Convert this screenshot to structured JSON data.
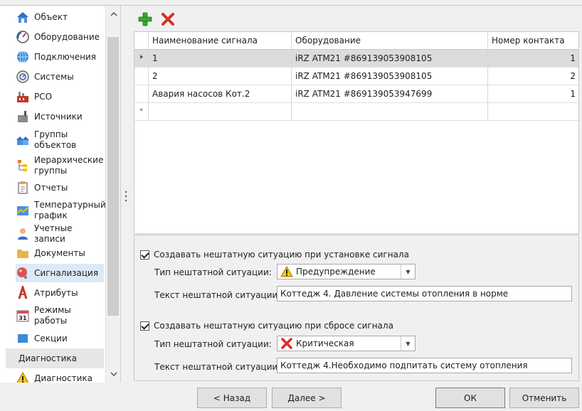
{
  "sidebar": {
    "items": [
      {
        "label": "Объект",
        "icon": "home-icon"
      },
      {
        "label": "Оборудование",
        "icon": "gauge-icon"
      },
      {
        "label": "Подключения",
        "icon": "globe-icon"
      },
      {
        "label": "Системы",
        "icon": "meter-icon"
      },
      {
        "label": "РСО",
        "icon": "factory-icon"
      },
      {
        "label": "Источники",
        "icon": "boiler-icon"
      },
      {
        "label": "Группы объектов",
        "icon": "houses-icon"
      },
      {
        "label": "Иерархические группы",
        "icon": "tree-icon"
      },
      {
        "label": "Отчеты",
        "icon": "report-icon"
      },
      {
        "label": "Температурный график",
        "icon": "temp-chart-icon"
      },
      {
        "label": "Учетные записи",
        "icon": "user-icon"
      },
      {
        "label": "Документы",
        "icon": "folder-icon"
      },
      {
        "label": "Сигнализация",
        "icon": "alarm-icon"
      },
      {
        "label": "Атрибуты",
        "icon": "attribute-icon"
      },
      {
        "label": "Режимы работы",
        "icon": "calendar-icon"
      },
      {
        "label": "Секции",
        "icon": "section-icon"
      }
    ],
    "calendar_day": "31",
    "section_header": "Диагностика",
    "partial_item": "Диагностика",
    "active_item": "Сигнализация"
  },
  "grid": {
    "columns": [
      "Наименование сигнала",
      "Оборудование",
      "Номер контакта"
    ],
    "rows": [
      {
        "name": "1",
        "equipment": "iRZ ATM21 #869139053908105",
        "contact": "1"
      },
      {
        "name": "2",
        "equipment": "iRZ ATM21 #869139053908105",
        "contact": "2"
      },
      {
        "name": "Авария насосов Кот.2",
        "equipment": "iRZ ATM21 #869139053947699",
        "contact": "1"
      }
    ],
    "new_row_marker": "*"
  },
  "props": {
    "set_signal": {
      "checkbox_label": "Создавать нештатную ситуацию при установке сигнала",
      "checked": true,
      "type_label": "Тип нештатной ситуации:",
      "type_value": "Предупреждение",
      "type_icon": "warning-icon",
      "text_label": "Текст нештатной ситуации:",
      "text_value": "Коттедж 4. Давление системы отопления в норме"
    },
    "reset_signal": {
      "checkbox_label": "Создавать нештатную ситуацию при сбросе сигнала",
      "checked": true,
      "type_label": "Тип нештатной ситуации:",
      "type_value": "Критическая",
      "type_icon": "critical-x-icon",
      "text_label": "Текст нештатной ситуации:",
      "text_value": "Коттедж 4.Необходимо подпитать систему отопления"
    }
  },
  "buttons": {
    "back": "< Назад",
    "next": "Далее >",
    "ok": "ОК",
    "cancel": "Отменить"
  },
  "colors": {
    "accent_selection": "#dde9f7",
    "grid_selected_row": "#dcdcdc",
    "add_green": "#3aa832",
    "delete_red": "#d93025",
    "warning_yellow": "#f5c518"
  }
}
